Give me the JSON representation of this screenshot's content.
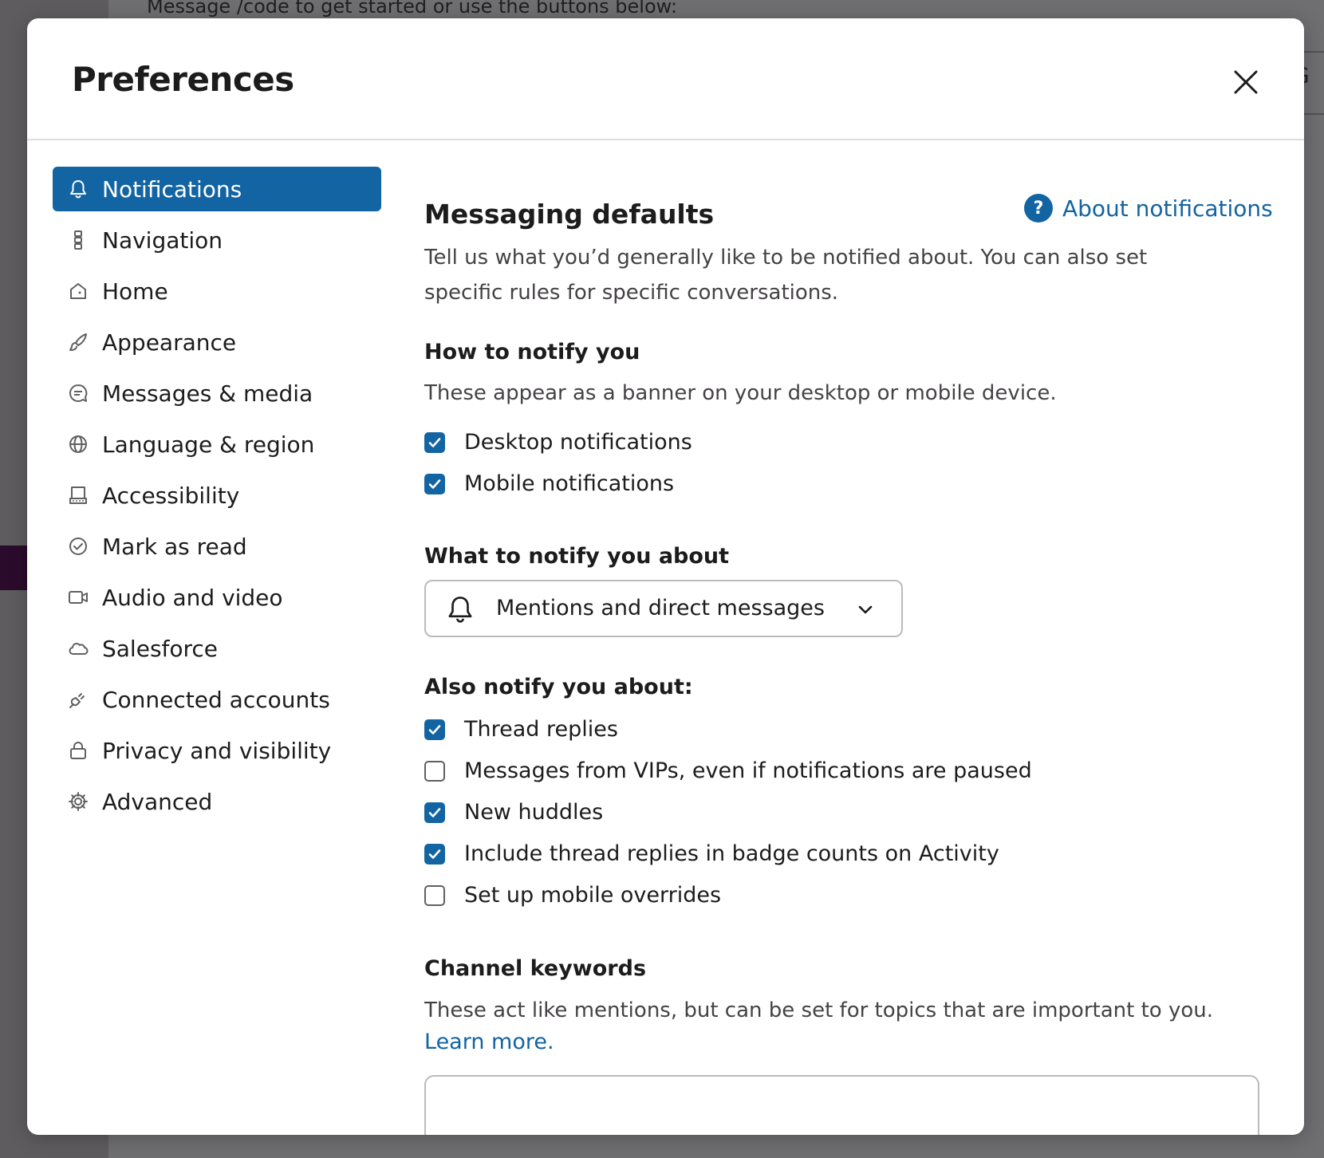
{
  "background": {
    "message_text": "Message /code to get started or use the buttons below:",
    "peek_text": "G"
  },
  "modal": {
    "title": "Preferences",
    "close_label": "Close"
  },
  "sidebar": {
    "items": [
      {
        "label": "Notifications",
        "icon": "bell-icon",
        "active": true
      },
      {
        "label": "Navigation",
        "icon": "navigation-icon",
        "active": false
      },
      {
        "label": "Home",
        "icon": "home-icon",
        "active": false
      },
      {
        "label": "Appearance",
        "icon": "brush-icon",
        "active": false
      },
      {
        "label": "Messages & media",
        "icon": "message-icon",
        "active": false
      },
      {
        "label": "Language & region",
        "icon": "globe-icon",
        "active": false
      },
      {
        "label": "Accessibility",
        "icon": "keyboard-icon",
        "active": false
      },
      {
        "label": "Mark as read",
        "icon": "check-circle-icon",
        "active": false
      },
      {
        "label": "Audio and video",
        "icon": "video-icon",
        "active": false
      },
      {
        "label": "Salesforce",
        "icon": "cloud-icon",
        "active": false
      },
      {
        "label": "Connected accounts",
        "icon": "plug-icon",
        "active": false
      },
      {
        "label": "Privacy and visibility",
        "icon": "lock-icon",
        "active": false
      },
      {
        "label": "Advanced",
        "icon": "gear-icon",
        "active": false
      }
    ]
  },
  "content": {
    "section_title": "Messaging defaults",
    "about_link": "About notifications",
    "section_desc": "Tell us what you’d generally like to be notified about. You can also set specific rules for specific conversations.",
    "how_title": "How to notify you",
    "how_desc": "These appear as a banner on your desktop or mobile device.",
    "how_options": [
      {
        "label": "Desktop notifications",
        "checked": true
      },
      {
        "label": "Mobile notifications",
        "checked": true
      }
    ],
    "what_title": "What to notify you about",
    "what_value": "Mentions and direct messages",
    "also_title": "Also notify you about:",
    "also_options": [
      {
        "label": "Thread replies",
        "checked": true
      },
      {
        "label": "Messages from VIPs, even if notifications are paused",
        "checked": false
      },
      {
        "label": "New huddles",
        "checked": true
      },
      {
        "label": "Include thread replies in badge counts on Activity",
        "checked": true
      },
      {
        "label": "Set up mobile overrides",
        "checked": false
      }
    ],
    "keywords_title": "Channel keywords",
    "keywords_desc": "These act like mentions, but can be set for topics that are important to you.",
    "learn_more": "Learn more."
  },
  "colors": {
    "accent": "#1264a3",
    "annotation_arrow": "#f20d0d"
  }
}
